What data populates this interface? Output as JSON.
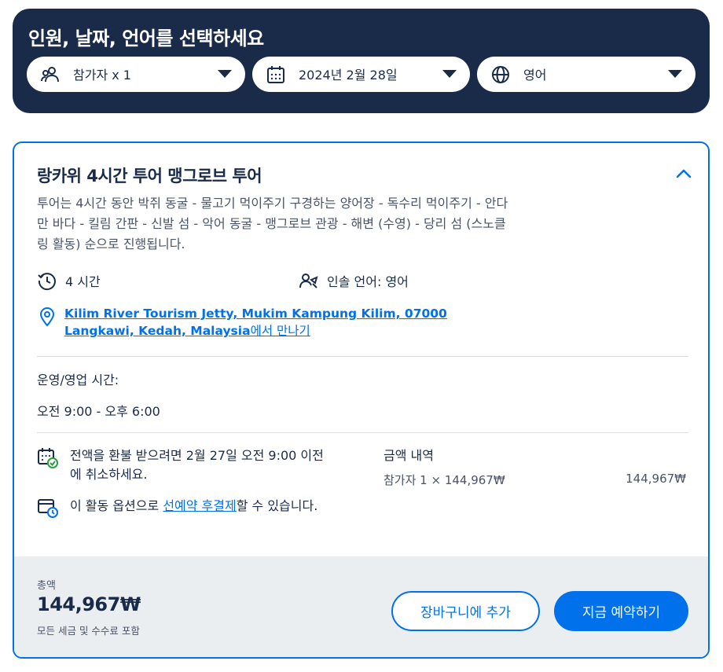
{
  "selector": {
    "title": "인원, 날짜, 언어를 선택하세요",
    "participants": "참가자 x 1",
    "date": "2024년 2월 28일",
    "language": "영어"
  },
  "option": {
    "title": "랑카위 4시간 투어 맹그로브 투어",
    "description": "투어는 4시간 동안 박쥐 동굴 - 물고기 먹이주기 구경하는 양어장 - 독수리 먹이주기 - 안다만 바다 - 킬림 간판 - 신발 섬 - 악어 동굴 - 맹그로브 관광 - 해변 (수영) - 당리 섬 (스노클링 활동) 순으로 진행됩니다.",
    "duration": "4 시간",
    "guide": "인솔 언어: 영어",
    "location_address": "Kilim River Tourism Jetty, Mukim Kampung Kilim, 07000 Langkawi, Kedah, Malaysia",
    "location_suffix": "에서 만나기",
    "hours_label": "운영/영업 시간:",
    "hours_value": "오전 9:00 - 오후 6:00",
    "cancel_text": "전액을 환불 받으려면 2월 27일 오전 9:00 이전에 취소하세요.",
    "reserve_prefix": "이 활동 옵션으로 ",
    "reserve_link": "선예약 후결제",
    "reserve_suffix": "할 수 있습니다.",
    "price_title": "금액 내역",
    "price_line": "참가자 1 × 144,967₩",
    "price_line_amount": "144,967₩"
  },
  "footer": {
    "total_label": "총액",
    "total_amount": "144,967₩",
    "total_note": "모든 세금 및 수수료 포함",
    "add_to_cart": "장바구니에 추가",
    "book_now": "지금 예약하기"
  },
  "colors": {
    "navy": "#1a2b49",
    "accent": "#0071eb",
    "footer_bg": "#ebeef1",
    "success": "#2a9d3f"
  },
  "icons": {
    "participants": "people-icon",
    "date": "calendar-icon",
    "language": "globe-icon",
    "duration": "clock-history-icon",
    "guide": "guide-person-icon",
    "location": "map-pin-icon",
    "cancel": "calendar-check-icon",
    "reserve": "calendar-clock-icon",
    "collapse": "chevron-up-icon"
  }
}
